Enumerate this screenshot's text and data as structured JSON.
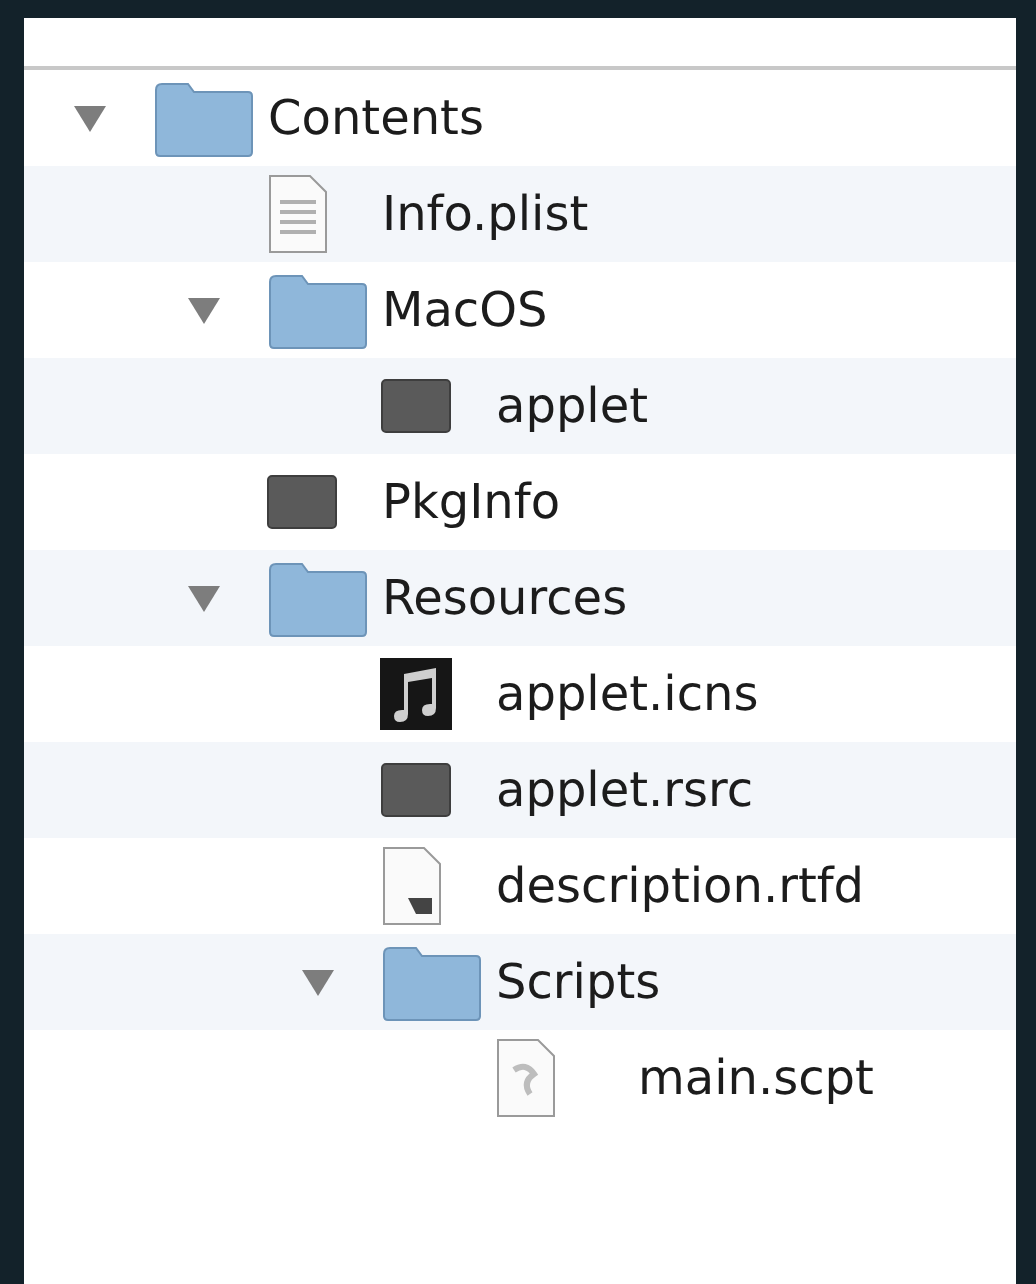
{
  "tree": [
    {
      "name": "Contents",
      "kind": "folder",
      "expanded": true,
      "children": [
        {
          "name": "Info.plist",
          "kind": "document"
        },
        {
          "name": "MacOS",
          "kind": "folder",
          "expanded": true,
          "children": [
            {
              "name": "applet",
              "kind": "binary"
            }
          ]
        },
        {
          "name": "PkgInfo",
          "kind": "binary"
        },
        {
          "name": "Resources",
          "kind": "folder",
          "expanded": true,
          "children": [
            {
              "name": "applet.icns",
              "kind": "music"
            },
            {
              "name": "applet.rsrc",
              "kind": "binary"
            },
            {
              "name": "description.rtfd",
              "kind": "rtfd"
            },
            {
              "name": "Scripts",
              "kind": "folder",
              "expanded": true,
              "children": [
                {
                  "name": "main.scpt",
                  "kind": "script"
                }
              ]
            }
          ]
        }
      ]
    }
  ]
}
